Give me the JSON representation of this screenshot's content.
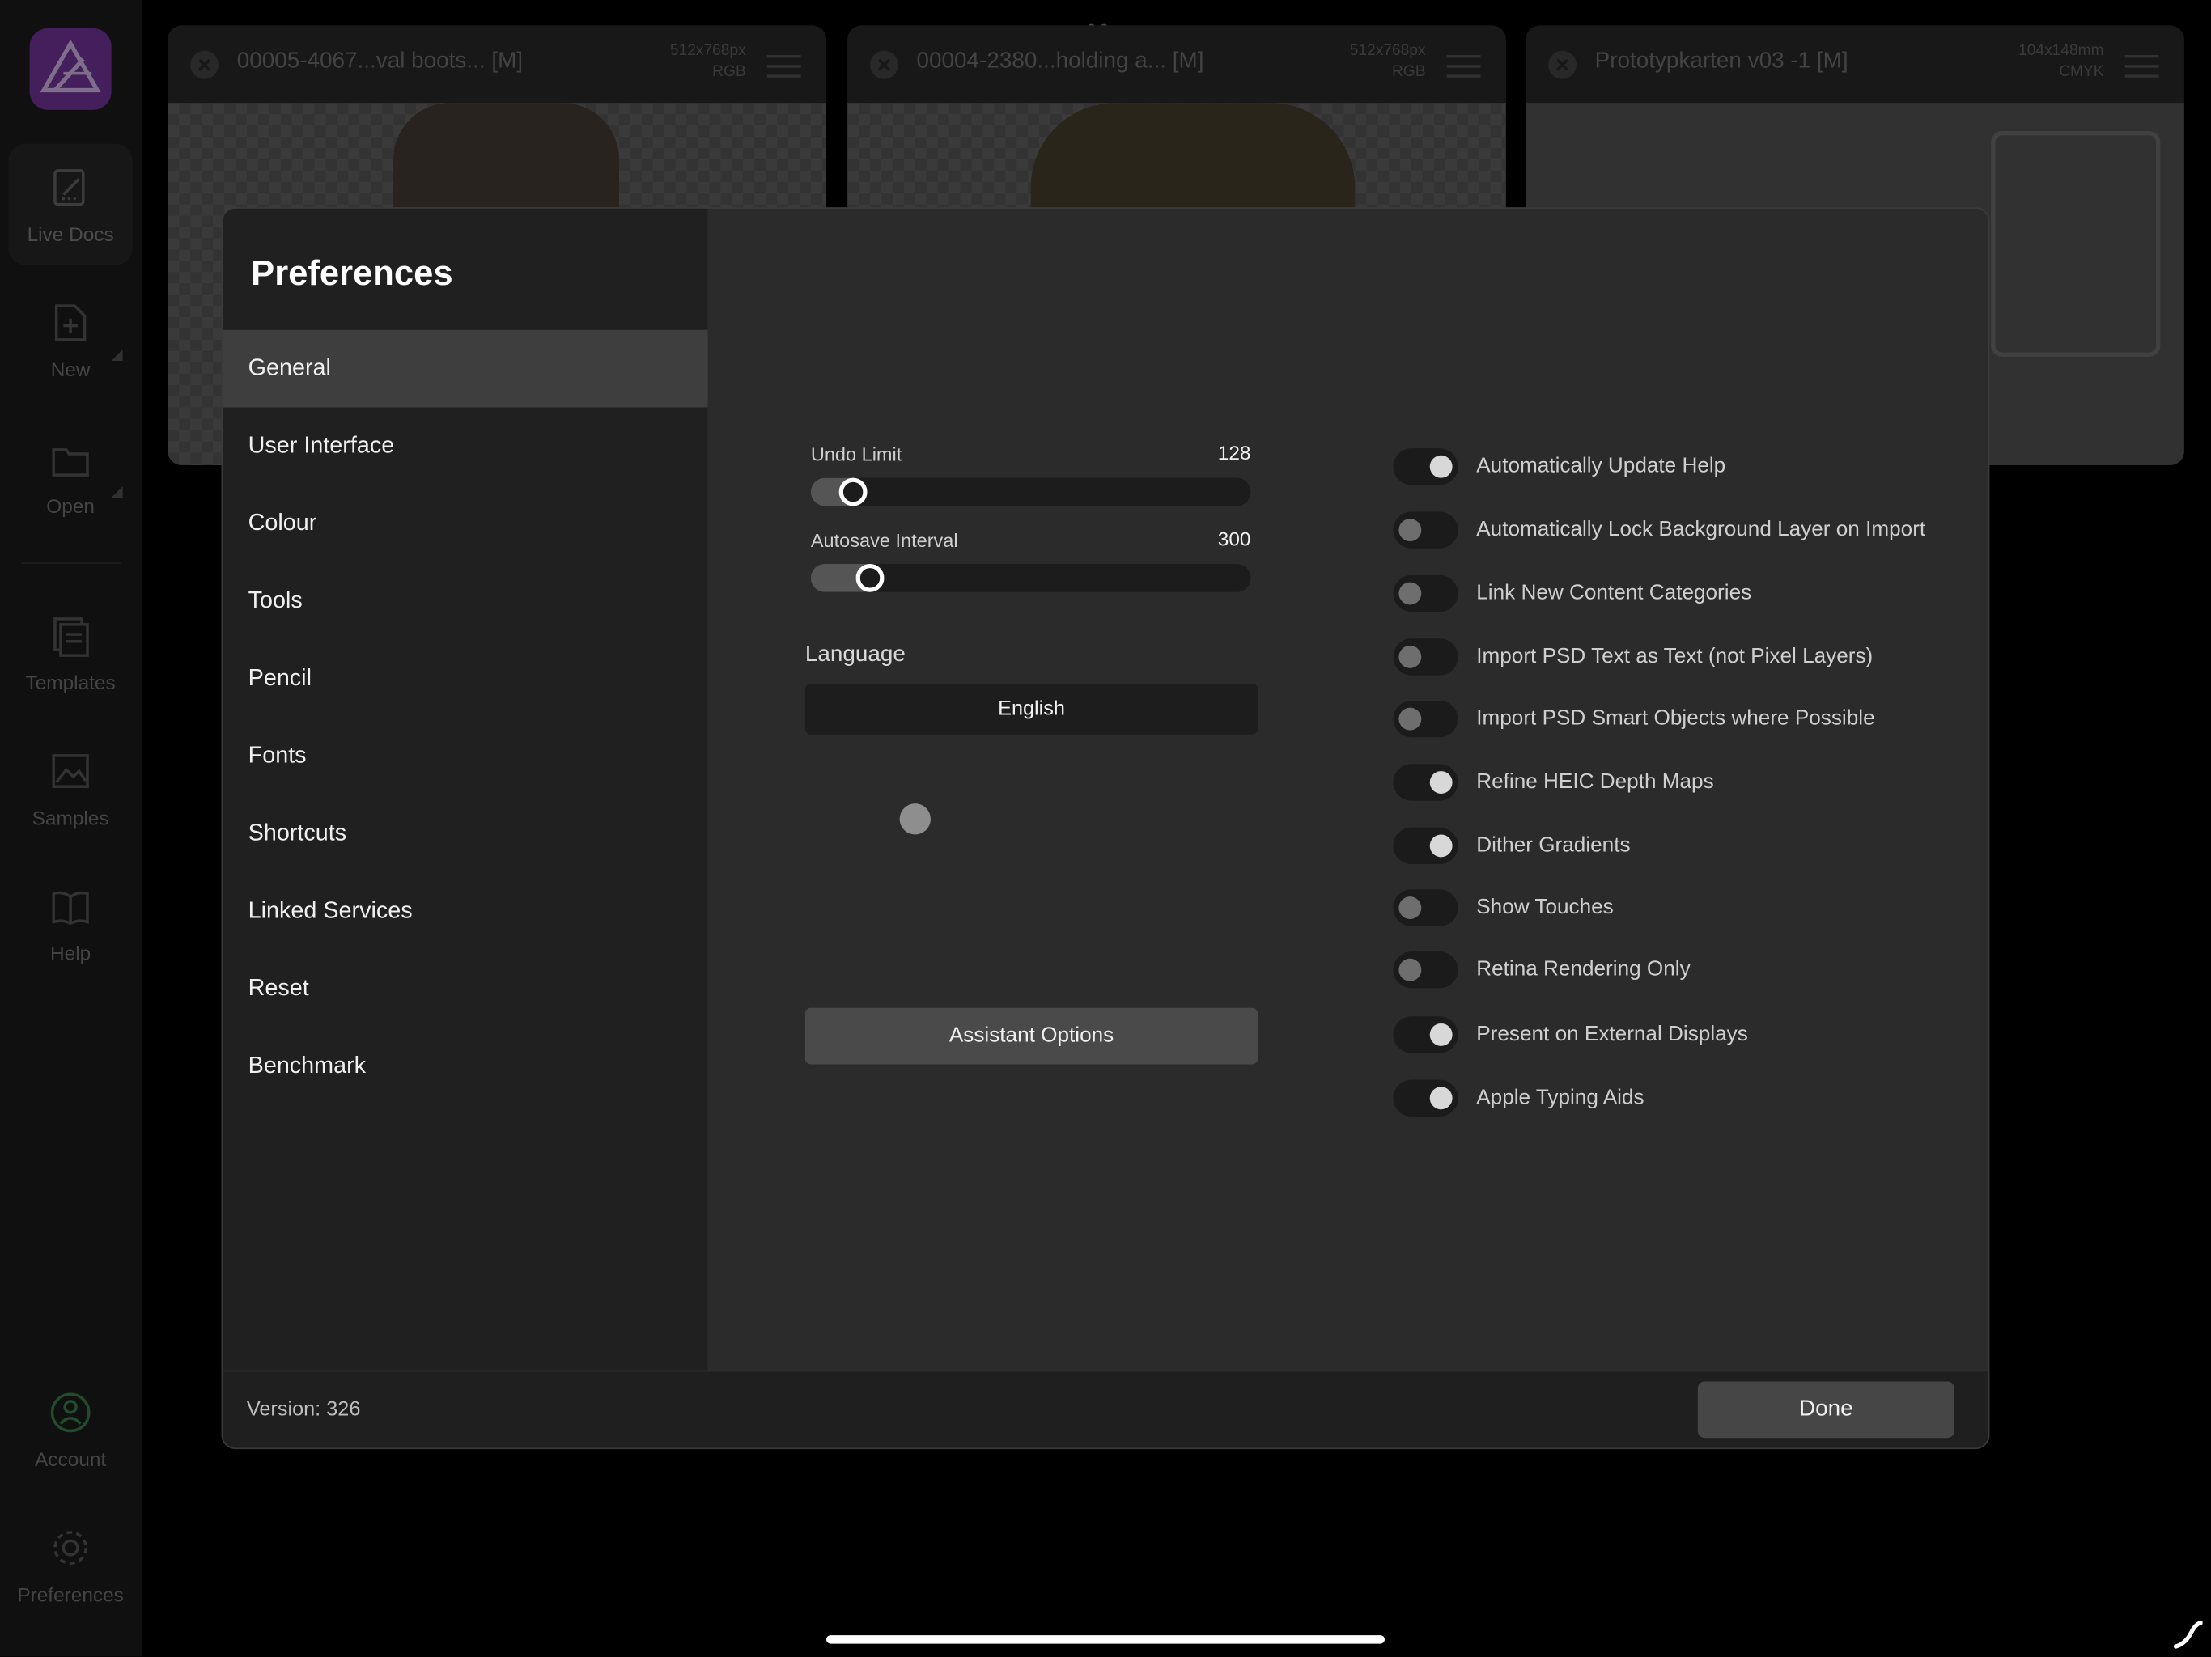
{
  "sidebar": {
    "items": [
      {
        "label": "Live Docs",
        "icon": "live-docs-icon"
      },
      {
        "label": "New",
        "icon": "new-document-icon"
      },
      {
        "label": "Open",
        "icon": "folder-icon"
      },
      {
        "label": "Templates",
        "icon": "templates-icon"
      },
      {
        "label": "Samples",
        "icon": "samples-icon"
      },
      {
        "label": "Help",
        "icon": "help-book-icon"
      },
      {
        "label": "Account",
        "icon": "account-icon"
      },
      {
        "label": "Preferences",
        "icon": "gear-icon"
      }
    ]
  },
  "tabs": [
    {
      "title": "00005-4067...val boots... [M]",
      "size": "512x768px",
      "mode": "RGB"
    },
    {
      "title": "00004-2380...holding a... [M]",
      "size": "512x768px",
      "mode": "RGB"
    },
    {
      "title": "Prototypkarten v03 -1 [M]",
      "size": "104x148mm",
      "mode": "CMYK"
    }
  ],
  "dialog": {
    "title": "Preferences",
    "categories": [
      "General",
      "User Interface",
      "Colour",
      "Tools",
      "Pencil",
      "Fonts",
      "Shortcuts",
      "Linked Services",
      "Reset",
      "Benchmark"
    ],
    "selected": "General",
    "undo": {
      "label": "Undo Limit",
      "value": "128",
      "fraction": 0.05
    },
    "autosave": {
      "label": "Autosave Interval",
      "value": "300",
      "fraction": 0.09
    },
    "language": {
      "label": "Language",
      "value": "English"
    },
    "assistant_button": "Assistant Options",
    "toggles": [
      {
        "label": "Automatically Update Help",
        "on": true
      },
      {
        "label": "Automatically Lock Background Layer on Import",
        "on": false
      },
      {
        "label": "Link New Content Categories",
        "on": false
      },
      {
        "label": "Import PSD Text as Text (not Pixel Layers)",
        "on": false
      },
      {
        "label": "Import PSD Smart Objects where Possible",
        "on": false
      },
      {
        "label": "Refine HEIC Depth Maps",
        "on": true
      },
      {
        "label": "Dither Gradients",
        "on": true
      },
      {
        "label": "Show Touches",
        "on": false
      },
      {
        "label": "Retina Rendering Only",
        "on": false
      },
      {
        "label": "Present on External Displays",
        "on": true
      },
      {
        "label": "Apple Typing Aids",
        "on": true
      }
    ],
    "version": "Version: 326",
    "done": "Done"
  },
  "colors": {
    "brand": "#7c3aa6",
    "panel": "#2b2b2b",
    "selected": "#3e3e3e"
  }
}
